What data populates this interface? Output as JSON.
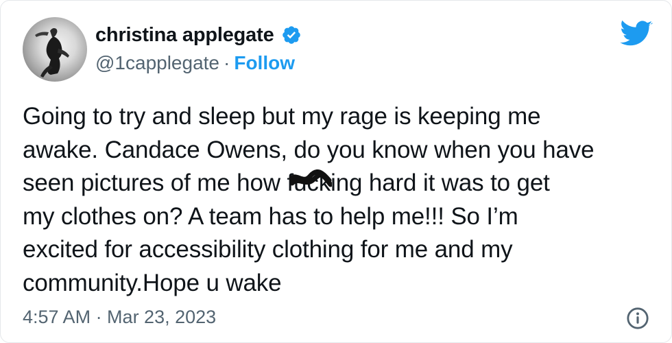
{
  "author": {
    "display_name": "christina applegate",
    "handle": "@1capplegate",
    "separator": "·",
    "follow_label": "Follow"
  },
  "tweet": {
    "lines": [
      "Going to try and sleep but my rage is keeping me",
      "awake. Candace Owens, do you know when you have",
      "seen pictures of me how f",
      "king hard it was to get",
      "my clothes on? A team has to help me!!! So I’m",
      "excited for accessibility clothing for me and my",
      "community.Hope u wake"
    ],
    "censored_word": "uc"
  },
  "footer": {
    "timestamp": "4:57 AM · Mar 23, 2023"
  },
  "icons": {
    "verified": "verified-badge-icon",
    "brand": "twitter-bird-icon",
    "info": "info-icon"
  },
  "colors": {
    "accent": "#1d9bf0",
    "secondary_text": "#536471",
    "primary_text": "#0f1419"
  }
}
